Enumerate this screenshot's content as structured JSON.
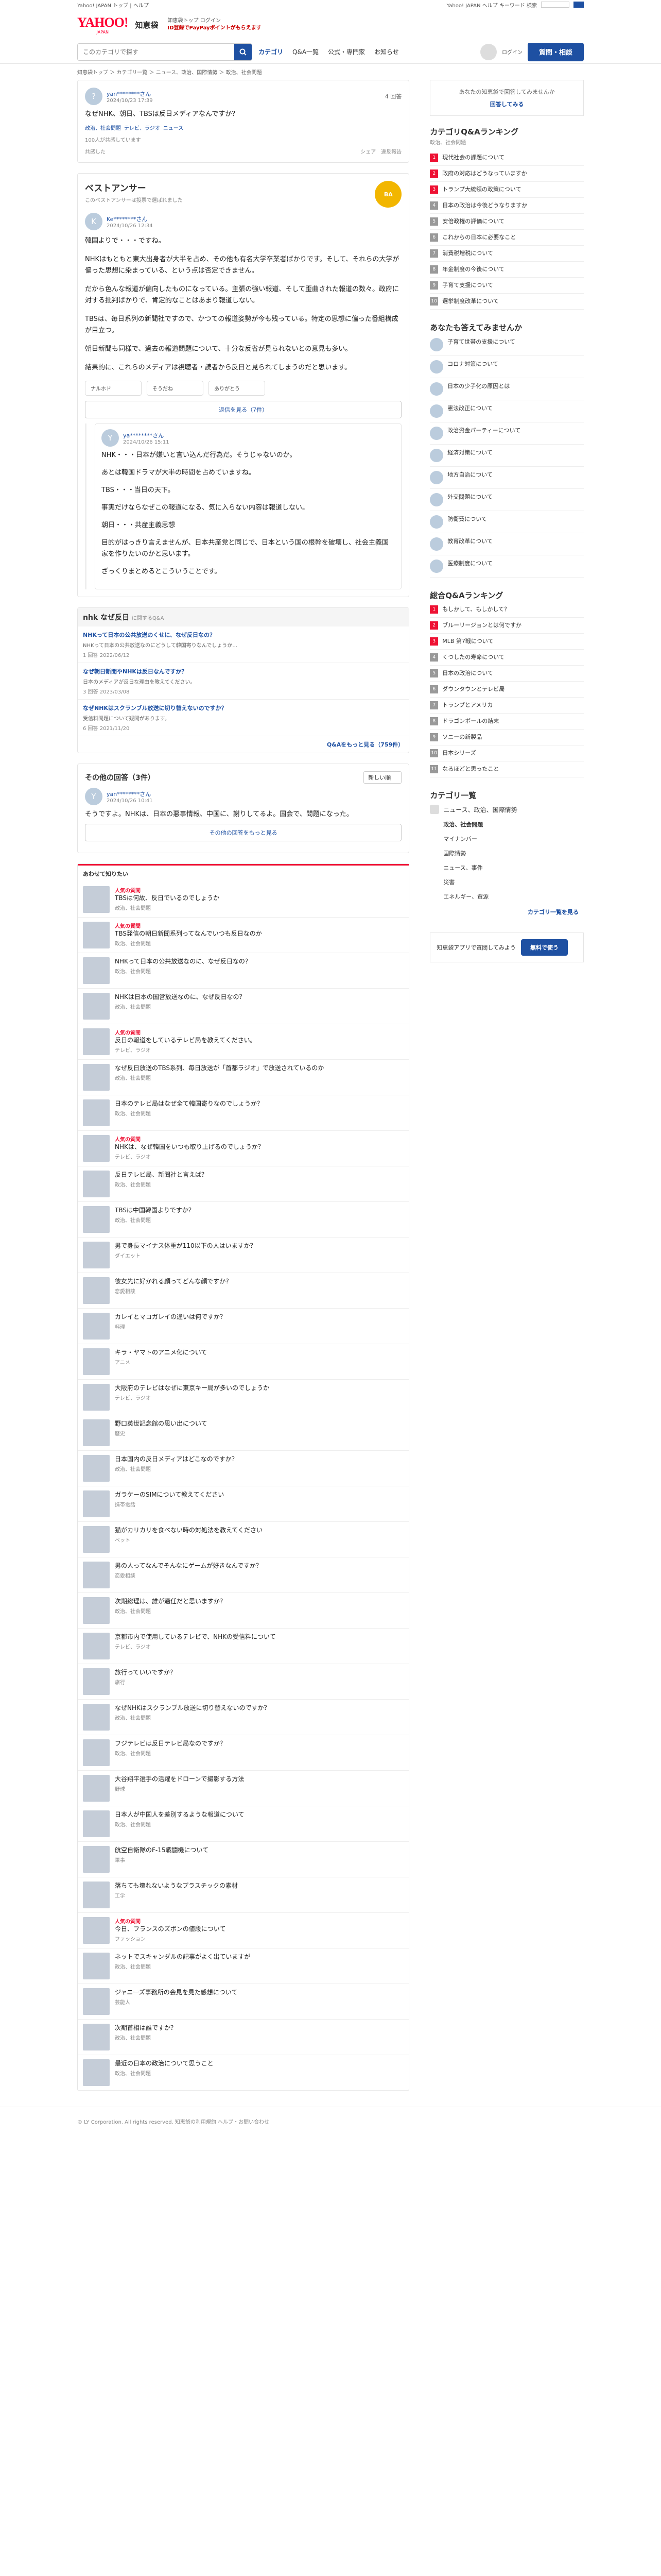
{
  "topbar": {
    "left": "Yahoo! JAPAN トップ | ヘルプ",
    "right": "Yahoo! JAPAN ヘルプ キーワード 検索"
  },
  "header": {
    "logo": "YAHOO!",
    "logo_sub": "JAPAN",
    "service": "知恵袋",
    "info": "知恵袋トップ ログイン",
    "notice": "ID登録でPayPayポイントがもらえます"
  },
  "nav": {
    "placeholder": "このカテゴリで探す",
    "items": [
      "カテゴリ",
      "Q&A一覧",
      "公式・専門家",
      "お知らせ"
    ],
    "ask": "質問・相談",
    "user": "ログイン"
  },
  "crumb": "知恵袋トップ ＞ カテゴリ一覧 ＞ ニュース、政治、国際情勢 ＞ 政治、社会問題",
  "question": {
    "user": "yan********さん",
    "date": "2024/10/23 17:39",
    "views": "4 回答",
    "body": "なぜNHK、朝日、TBSは反日メディアなんですか？",
    "tags": [
      "政治、社会問題",
      "テレビ、ラジオ",
      "ニュース"
    ],
    "reason": "100人が共感しています",
    "acts": [
      "共感した",
      "違反報告"
    ],
    "share": "シェア"
  },
  "best": {
    "label": "ベストアンサー",
    "sub": "このベストアンサーは投票で選ばれました",
    "user": "Ke********さん",
    "date": "2024/10/26 12:34",
    "medal": "BA",
    "paras": [
      "韓国よりで・・・ですね。",
      "NHKはもともと東大出身者が大半を占め、その他も有名大学卒業者ばかりです。そして、それらの大学が偏った思想に染まっている、という点は否定できません。",
      "だから色んな報道が偏向したものになっている。主張の強い報道、そして歪曲された報道の数々。政府に対する批判ばかりで、肯定的なことはあまり報道しない。",
      "TBSは、毎日系列の新聞社ですので、かつての報道姿勢が今も残っている。特定の思想に偏った番組構成が目立つ。",
      "朝日新聞も同様で、過去の報道問題について、十分な反省が見られないとの意見も多い。",
      "結果的に、これらのメディアは視聴者・読者から反日と見られてしまうのだと思います。"
    ],
    "react": [
      "ナルホド",
      "そうだね",
      "ありがとう"
    ],
    "replies_btn": "返信を見る（7件）"
  },
  "replies": [
    {
      "user": "ya********さん",
      "date": "2024/10/26 15:11",
      "paras": [
        "NHK・・・日本が嫌いと言い込んだ行為だ。そうじゃないのか。",
        "あとは韓国ドラマが大半の時間を占めていますね。",
        "TBS・・・当日の天下。",
        "事実だけならなぜこの報道になる、気に入らない内容は報道しない。",
        "朝日・・・共産主義思想",
        "目的がはっきり言えませんが、日本共産党と同じで、日本という国の根幹を破壊し、社会主義国家を作りたいのかと思います。",
        "ざっくりまとめるとこういうことです。"
      ]
    }
  ],
  "related": {
    "title": "nhk なぜ反日",
    "sub": "に関するQ&A",
    "items": [
      {
        "t": "NHKって日本の公共放送のくせに、なぜ反日なの？",
        "d": "NHKって日本の公共放送なのにどうして韓国寄りなんでしょうか…",
        "m": "1 回答 2022/06/12"
      },
      {
        "t": "なぜ朝日新聞やNHKは反日なんですか？",
        "d": "日本のメディアが反日な理由を教えてください。",
        "m": "3 回答 2023/03/08"
      },
      {
        "t": "なぜNHKはスクランブル放送に切り替えないのですか？",
        "d": "受信料問題について疑問があります。",
        "m": "6 回答 2021/11/20"
      }
    ],
    "more": "Q&Aをもっと見る（759件）"
  },
  "others": {
    "title": "その他の回答（3件）",
    "sort": "新しい順",
    "ans": [
      {
        "user": "yan********さん",
        "date": "2024/10/26 10:41",
        "body": "そうですよ。NHKは、日本の悪事情報、中国に、謝りしてるよ。国会で、問題になった。"
      }
    ],
    "more": "その他の回答をもっと見る"
  },
  "seen": {
    "title": "あわせて知りたい",
    "items": [
      {
        "t": "TBSは何故、反日でいるのでしょうか",
        "c": "政治、社会問題",
        "hot": "人気の質問"
      },
      {
        "t": "TBS発信の朝日新聞系列ってなんでいつも反日なのか",
        "c": "政治、社会問題",
        "hot": "人気の質問"
      },
      {
        "t": "NHKって日本の公共放送なのに、なぜ反日なの？",
        "c": "政治、社会問題",
        "hot": ""
      },
      {
        "t": "NHKは日本の国営放送なのに、なぜ反日なの？",
        "c": "政治、社会問題",
        "hot": ""
      },
      {
        "t": "反日の報道をしているテレビ局を教えてください。",
        "c": "テレビ、ラジオ",
        "hot": "人気の質問"
      },
      {
        "t": "なぜ反日放送のTBS系列、毎日放送が「首都ラジオ」で放送されているのか",
        "c": "政治、社会問題",
        "hot": ""
      },
      {
        "t": "日本のテレビ局はなぜ全て韓国寄りなのでしょうか？",
        "c": "政治、社会問題",
        "hot": ""
      },
      {
        "t": "NHKは、なぜ韓国をいつも取り上げるのでしょうか？",
        "c": "テレビ、ラジオ",
        "hot": "人気の質問"
      },
      {
        "t": "反日テレビ局、新聞社と言えば？",
        "c": "政治、社会問題",
        "hot": ""
      },
      {
        "t": "TBSは中国韓国よりですか？",
        "c": "政治、社会問題",
        "hot": ""
      },
      {
        "t": "男で身長マイナス体重が110以下の人はいますか？",
        "c": "ダイエット",
        "hot": ""
      },
      {
        "t": "彼女先に好かれる顔ってどんな顔ですか？",
        "c": "恋愛相談",
        "hot": ""
      },
      {
        "t": "カレイとマコガレイの違いは何ですか？",
        "c": "料理",
        "hot": ""
      },
      {
        "t": "キラ・ヤマトのアニメ化について",
        "c": "アニメ",
        "hot": ""
      },
      {
        "t": "大阪府のテレビはなぜに東京キー局が多いのでしょうか",
        "c": "テレビ、ラジオ",
        "hot": ""
      },
      {
        "t": "野口英世記念館の思い出について",
        "c": "歴史",
        "hot": ""
      },
      {
        "t": "日本国内の反日メディアはどこなのですか？",
        "c": "政治、社会問題",
        "hot": ""
      },
      {
        "t": "ガラケーのSIMについて教えてください",
        "c": "携帯電話",
        "hot": ""
      },
      {
        "t": "猫がカリカリを食べない時の対処法を教えてください",
        "c": "ペット",
        "hot": ""
      },
      {
        "t": "男の人ってなんでそんなにゲームが好きなんですか？",
        "c": "恋愛相談",
        "hot": ""
      },
      {
        "t": "次期総理は、誰が適任だと思いますか？",
        "c": "政治、社会問題",
        "hot": ""
      },
      {
        "t": "京都市内で使用しているテレビで、NHKの受信料について",
        "c": "テレビ、ラジオ",
        "hot": ""
      },
      {
        "t": "旅行っていいですか？",
        "c": "旅行",
        "hot": ""
      },
      {
        "t": "なぜNHKはスクランブル放送に切り替えないのですか？",
        "c": "政治、社会問題",
        "hot": ""
      },
      {
        "t": "フジテレビは反日テレビ局なのですか？",
        "c": "政治、社会問題",
        "hot": ""
      },
      {
        "t": "大谷翔平選手の活躍をドローンで撮影する方法",
        "c": "野球",
        "hot": ""
      },
      {
        "t": "日本人が中国人を差別するような報道について",
        "c": "政治、社会問題",
        "hot": ""
      },
      {
        "t": "航空自衛隊のF-15戦闘機について",
        "c": "軍事",
        "hot": ""
      },
      {
        "t": "落ちても壊れないようなプラスチックの素材",
        "c": "工学",
        "hot": ""
      },
      {
        "t": "今日、フランスのズボンの値段について",
        "c": "ファッション",
        "hot": "人気の質問"
      },
      {
        "t": "ネットでスキャンダルの記事がよく出ていますが",
        "c": "政治、社会問題",
        "hot": ""
      },
      {
        "t": "ジャニーズ事務所の会見を見た感想について",
        "c": "芸能人",
        "hot": ""
      },
      {
        "t": "次期首相は誰ですか？",
        "c": "政治、社会問題",
        "hot": ""
      },
      {
        "t": "最近の日本の政治について思うこと",
        "c": "政治、社会問題",
        "hot": ""
      }
    ]
  },
  "side": {
    "ad": {
      "t": "あなたの知恵袋で回答してみませんか",
      "b": "回答してみる"
    },
    "ranking": {
      "title": "カテゴリQ&Aランキング",
      "sub": "政治、社会問題",
      "items": [
        "現代社会の課題について",
        "政府の対応はどうなっていますか",
        "トランプ大統領の政策について",
        "日本の政治は今後どうなりますか",
        "安倍政権の評価について",
        "これからの日本に必要なこと",
        "消費税増税について",
        "年金制度の今後について",
        "子育て支援について",
        "選挙制度改革について"
      ]
    },
    "want": {
      "title": "あなたも答えてみませんか",
      "items": [
        "子育て世帯の支援について",
        "コロナ対策について",
        "日本の少子化の原因とは",
        "憲法改正について",
        "政治資金パーティーについて",
        "経済対策について",
        "地方自治について",
        "外交問題について",
        "防衛費について",
        "教育改革について",
        "医療制度について"
      ]
    },
    "overall": {
      "title": "総合Q&Aランキング",
      "items": [
        "もしかして、もしかして？",
        "ブルーリージョンとは何ですか",
        "MLB 第7戦について",
        "くつしたの寿命について",
        "日本の政治について",
        "ダウンタウンとテレビ局",
        "トランプとアメリカ",
        "ドラゴンボールの結末",
        "ソニーの新製品",
        "日本シリーズ",
        "なるほどと思ったこと"
      ]
    },
    "cats": {
      "title": "カテゴリ一覧",
      "items": [
        "ニュース、政治、国際情勢",
        "政治、社会問題",
        "マイナンバー",
        "国際情勢",
        "ニュース、事件",
        "災害",
        "エネルギー、資源"
      ],
      "more": "カテゴリ一覧を見る"
    },
    "app": {
      "t": "知恵袋アプリで質問してみよう",
      "b": "無料で使う"
    }
  },
  "footer": "© LY Corporation. All rights reserved. 知恵袋の利用規約 ヘルプ・お問い合わせ"
}
